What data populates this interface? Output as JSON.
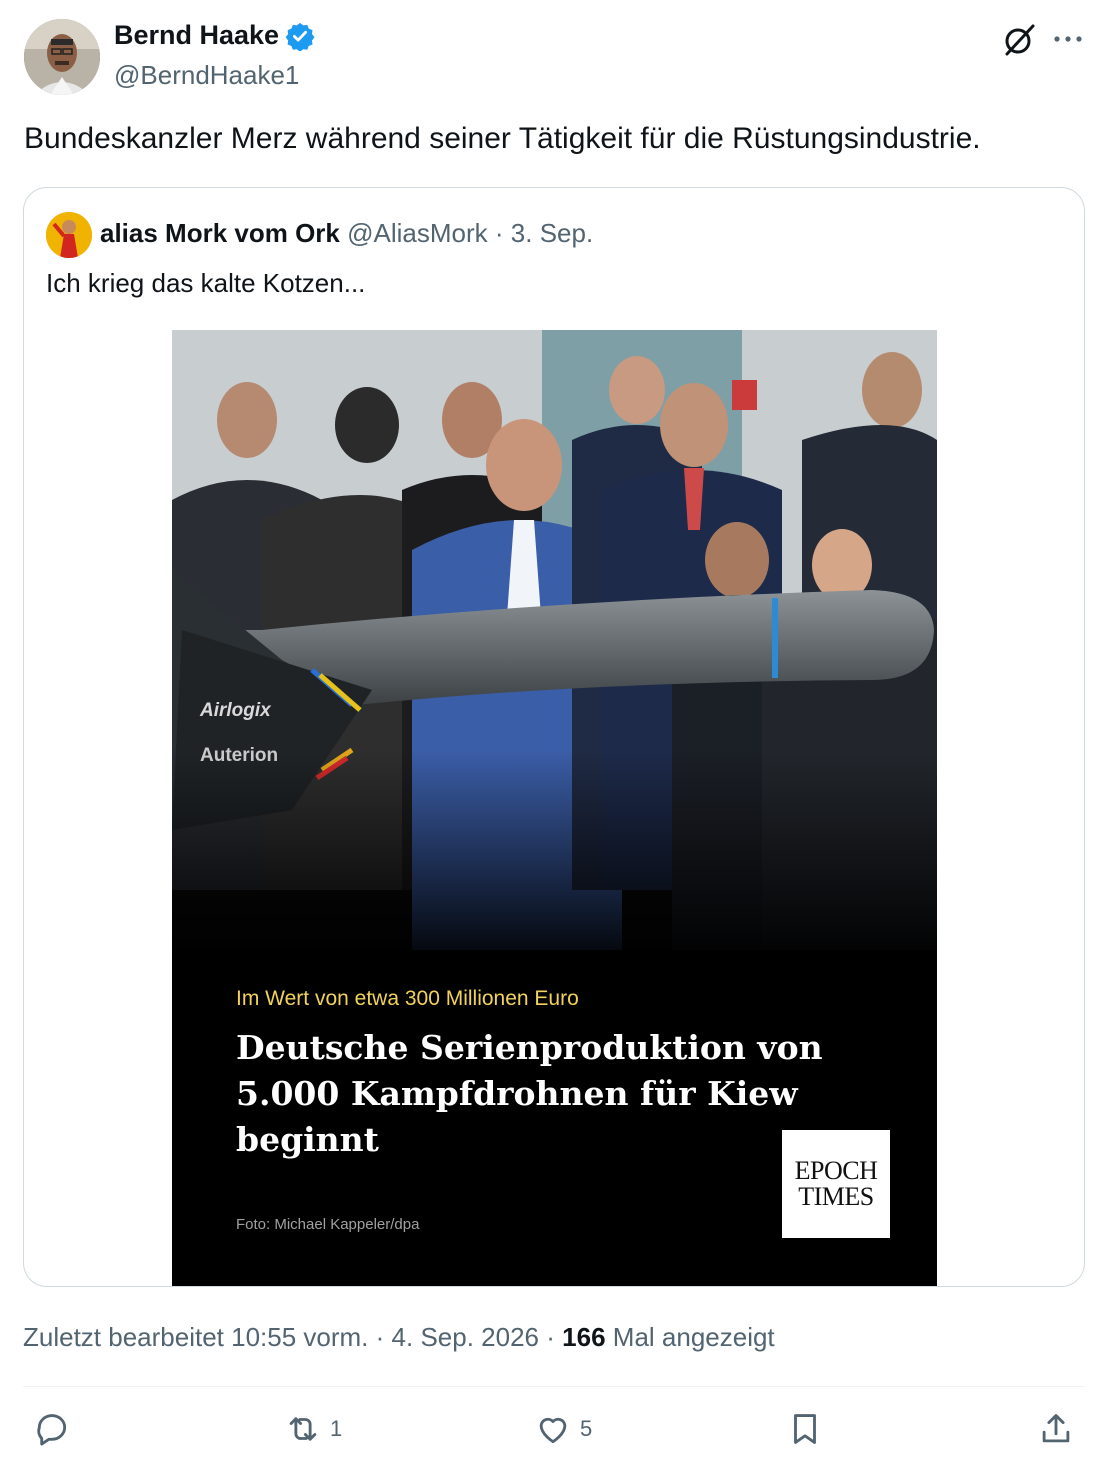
{
  "author": {
    "display_name": "Bernd Haake",
    "handle": "@BerndHaake1",
    "verified": true
  },
  "tweet": {
    "text": "Bundeskanzler Merz während seiner Tätigkeit für die Rüstungsindustrie."
  },
  "quoted_tweet": {
    "display_name": "alias Mork vom Ork",
    "handle": "@AliasMork",
    "separator": "·",
    "date": "3. Sep.",
    "text": "Ich krieg das kalte Kotzen...",
    "media": {
      "kicker": "Im Wert von etwa 300 Millionen Euro",
      "headline": "Deutsche Serienproduktion von 5.000 Kampfdrohnen für Kiew beginnt",
      "credit": "Foto: Michael Kappeler/dpa",
      "logo_line1": "EPOCH",
      "logo_line2": "TIMES",
      "drone_label_1": "Airlogix",
      "drone_label_2": "Auterion"
    }
  },
  "meta": {
    "edited": "Zuletzt bearbeitet 10:55 vorm.",
    "sep1": "·",
    "date": "4. Sep. 2026",
    "sep2": "·",
    "views_count": "166",
    "views_label": "Mal angezeigt"
  },
  "actions": {
    "reply_count": "",
    "retweet_count": "1",
    "like_count": "5"
  },
  "colors": {
    "verified_blue": "#1d9bf0",
    "secondary_text": "#536471",
    "primary_text": "#0f1419",
    "kicker_yellow": "#f1d25a"
  },
  "icons": [
    "verified-badge-icon",
    "grok-icon",
    "more-icon",
    "reply-icon",
    "retweet-icon",
    "like-icon",
    "bookmark-icon",
    "share-icon"
  ]
}
